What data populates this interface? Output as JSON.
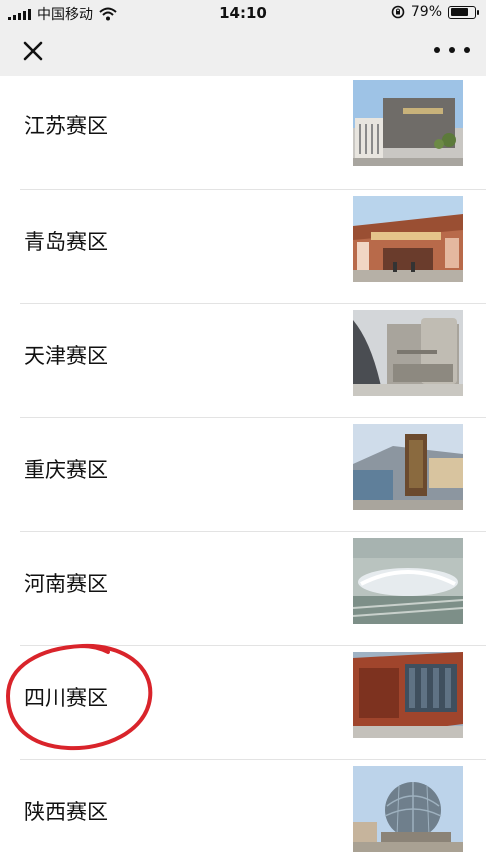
{
  "status_bar": {
    "carrier": "中国移动",
    "time": "14:10",
    "battery_percent": "79%",
    "battery_level": 0.79,
    "icons": [
      "signal-icon",
      "wifi-icon",
      "orientation-lock-icon",
      "battery-icon"
    ]
  },
  "nav": {
    "close_icon": "close-icon",
    "more_icon": "more-dots-icon"
  },
  "regions": [
    {
      "label": "江苏赛区",
      "thumbnail": "museum-building-photo"
    },
    {
      "label": "青岛赛区",
      "thumbnail": "gate-building-photo"
    },
    {
      "label": "天津赛区",
      "thumbnail": "curved-building-photo"
    },
    {
      "label": "重庆赛区",
      "thumbnail": "museum-sign-photo"
    },
    {
      "label": "河南赛区",
      "thumbnail": "aerial-station-photo"
    },
    {
      "label": "四川赛区",
      "thumbnail": "red-building-photo"
    },
    {
      "label": "陕西赛区",
      "thumbnail": "dome-building-photo"
    }
  ],
  "annotation": {
    "highlighted_item": "四川赛区",
    "color": "#d9242b"
  }
}
